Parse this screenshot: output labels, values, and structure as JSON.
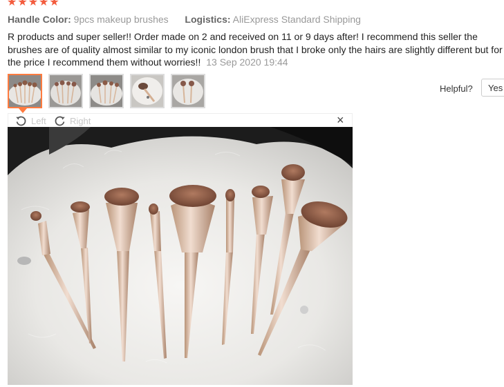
{
  "review": {
    "stars": "★★★★★",
    "handle_color_label": "Handle Color:",
    "handle_color_value": "9pcs makeup brushes",
    "logistics_label": "Logistics:",
    "logistics_value": "AliExpress Standard Shipping",
    "text": "R products and super seller!! Order made on 2 and received on 11 or 9 days after! I recommend this seller the brushes are of quality almost similar to my iconic london brush that I broke only the hairs are slightly different but for the price I recommend them without worries!!",
    "date": "13 Sep 2020 19:44",
    "star_color": "#f35c3e"
  },
  "helpful": {
    "label": "Helpful?",
    "yes_label": "Yes"
  },
  "viewer": {
    "rotate_left_label": "Left",
    "rotate_right_label": "Right",
    "close_label": "×",
    "accent_color": "#ff7b3f"
  },
  "thumbnails": [
    {
      "alt": "photo-1",
      "active": true
    },
    {
      "alt": "photo-2",
      "active": false
    },
    {
      "alt": "photo-3",
      "active": false
    },
    {
      "alt": "photo-4",
      "active": false
    },
    {
      "alt": "photo-5",
      "active": false
    }
  ]
}
